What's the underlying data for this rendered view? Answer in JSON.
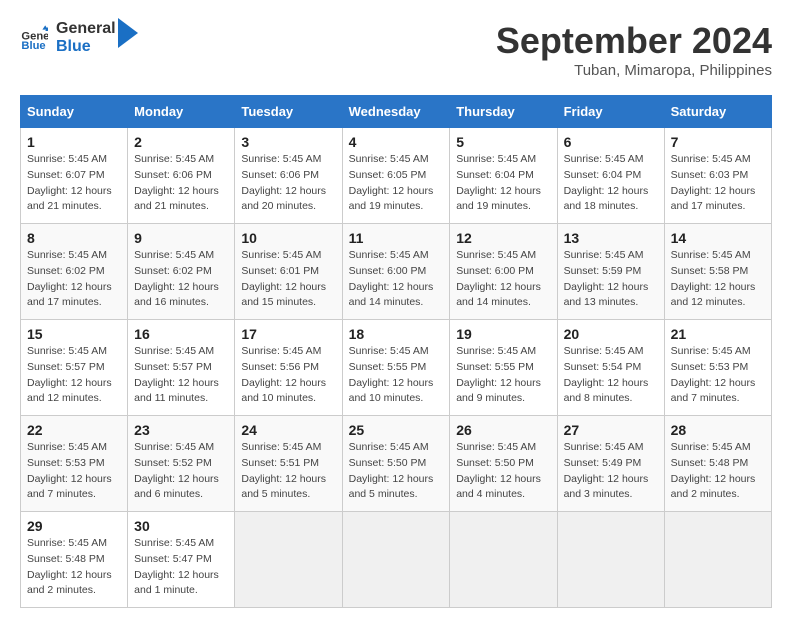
{
  "logo": {
    "text_general": "General",
    "text_blue": "Blue"
  },
  "header": {
    "month_year": "September 2024",
    "location": "Tuban, Mimaropa, Philippines"
  },
  "weekdays": [
    "Sunday",
    "Monday",
    "Tuesday",
    "Wednesday",
    "Thursday",
    "Friday",
    "Saturday"
  ],
  "weeks": [
    [
      {
        "day": "1",
        "info": "Sunrise: 5:45 AM\nSunset: 6:07 PM\nDaylight: 12 hours\nand 21 minutes."
      },
      {
        "day": "2",
        "info": "Sunrise: 5:45 AM\nSunset: 6:06 PM\nDaylight: 12 hours\nand 21 minutes."
      },
      {
        "day": "3",
        "info": "Sunrise: 5:45 AM\nSunset: 6:06 PM\nDaylight: 12 hours\nand 20 minutes."
      },
      {
        "day": "4",
        "info": "Sunrise: 5:45 AM\nSunset: 6:05 PM\nDaylight: 12 hours\nand 19 minutes."
      },
      {
        "day": "5",
        "info": "Sunrise: 5:45 AM\nSunset: 6:04 PM\nDaylight: 12 hours\nand 19 minutes."
      },
      {
        "day": "6",
        "info": "Sunrise: 5:45 AM\nSunset: 6:04 PM\nDaylight: 12 hours\nand 18 minutes."
      },
      {
        "day": "7",
        "info": "Sunrise: 5:45 AM\nSunset: 6:03 PM\nDaylight: 12 hours\nand 17 minutes."
      }
    ],
    [
      {
        "day": "8",
        "info": "Sunrise: 5:45 AM\nSunset: 6:02 PM\nDaylight: 12 hours\nand 17 minutes."
      },
      {
        "day": "9",
        "info": "Sunrise: 5:45 AM\nSunset: 6:02 PM\nDaylight: 12 hours\nand 16 minutes."
      },
      {
        "day": "10",
        "info": "Sunrise: 5:45 AM\nSunset: 6:01 PM\nDaylight: 12 hours\nand 15 minutes."
      },
      {
        "day": "11",
        "info": "Sunrise: 5:45 AM\nSunset: 6:00 PM\nDaylight: 12 hours\nand 14 minutes."
      },
      {
        "day": "12",
        "info": "Sunrise: 5:45 AM\nSunset: 6:00 PM\nDaylight: 12 hours\nand 14 minutes."
      },
      {
        "day": "13",
        "info": "Sunrise: 5:45 AM\nSunset: 5:59 PM\nDaylight: 12 hours\nand 13 minutes."
      },
      {
        "day": "14",
        "info": "Sunrise: 5:45 AM\nSunset: 5:58 PM\nDaylight: 12 hours\nand 12 minutes."
      }
    ],
    [
      {
        "day": "15",
        "info": "Sunrise: 5:45 AM\nSunset: 5:57 PM\nDaylight: 12 hours\nand 12 minutes."
      },
      {
        "day": "16",
        "info": "Sunrise: 5:45 AM\nSunset: 5:57 PM\nDaylight: 12 hours\nand 11 minutes."
      },
      {
        "day": "17",
        "info": "Sunrise: 5:45 AM\nSunset: 5:56 PM\nDaylight: 12 hours\nand 10 minutes."
      },
      {
        "day": "18",
        "info": "Sunrise: 5:45 AM\nSunset: 5:55 PM\nDaylight: 12 hours\nand 10 minutes."
      },
      {
        "day": "19",
        "info": "Sunrise: 5:45 AM\nSunset: 5:55 PM\nDaylight: 12 hours\nand 9 minutes."
      },
      {
        "day": "20",
        "info": "Sunrise: 5:45 AM\nSunset: 5:54 PM\nDaylight: 12 hours\nand 8 minutes."
      },
      {
        "day": "21",
        "info": "Sunrise: 5:45 AM\nSunset: 5:53 PM\nDaylight: 12 hours\nand 7 minutes."
      }
    ],
    [
      {
        "day": "22",
        "info": "Sunrise: 5:45 AM\nSunset: 5:53 PM\nDaylight: 12 hours\nand 7 minutes."
      },
      {
        "day": "23",
        "info": "Sunrise: 5:45 AM\nSunset: 5:52 PM\nDaylight: 12 hours\nand 6 minutes."
      },
      {
        "day": "24",
        "info": "Sunrise: 5:45 AM\nSunset: 5:51 PM\nDaylight: 12 hours\nand 5 minutes."
      },
      {
        "day": "25",
        "info": "Sunrise: 5:45 AM\nSunset: 5:50 PM\nDaylight: 12 hours\nand 5 minutes."
      },
      {
        "day": "26",
        "info": "Sunrise: 5:45 AM\nSunset: 5:50 PM\nDaylight: 12 hours\nand 4 minutes."
      },
      {
        "day": "27",
        "info": "Sunrise: 5:45 AM\nSunset: 5:49 PM\nDaylight: 12 hours\nand 3 minutes."
      },
      {
        "day": "28",
        "info": "Sunrise: 5:45 AM\nSunset: 5:48 PM\nDaylight: 12 hours\nand 2 minutes."
      }
    ],
    [
      {
        "day": "29",
        "info": "Sunrise: 5:45 AM\nSunset: 5:48 PM\nDaylight: 12 hours\nand 2 minutes."
      },
      {
        "day": "30",
        "info": "Sunrise: 5:45 AM\nSunset: 5:47 PM\nDaylight: 12 hours\nand 1 minute."
      },
      {
        "day": "",
        "info": ""
      },
      {
        "day": "",
        "info": ""
      },
      {
        "day": "",
        "info": ""
      },
      {
        "day": "",
        "info": ""
      },
      {
        "day": "",
        "info": ""
      }
    ]
  ]
}
